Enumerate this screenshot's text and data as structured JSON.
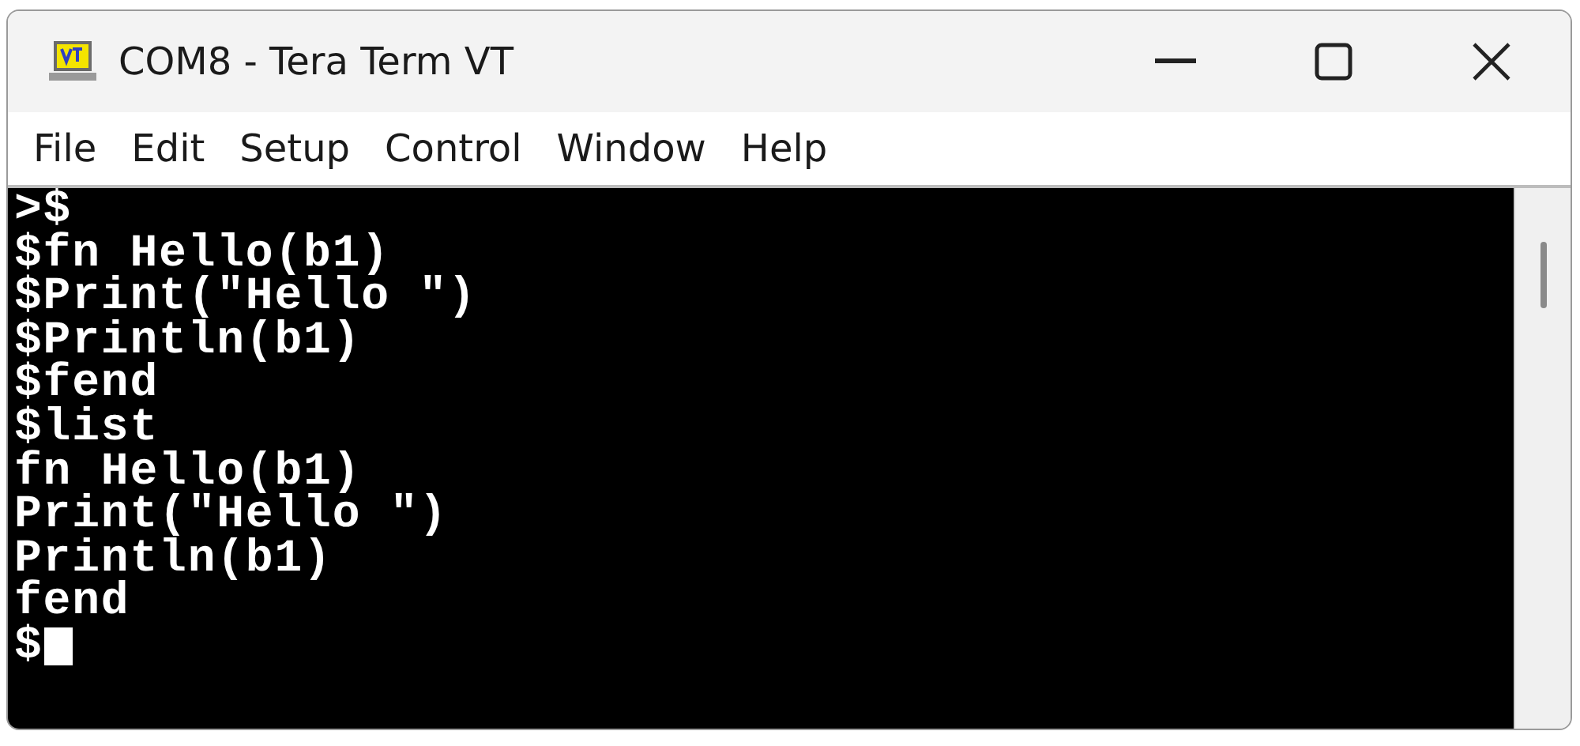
{
  "window": {
    "title": "COM8 - Tera Term VT"
  },
  "menu": [
    "File",
    "Edit",
    "Setup",
    "Control",
    "Window",
    "Help"
  ],
  "terminal": {
    "lines": [
      ">$",
      "$fn Hello(b1)",
      "$Print(\"Hello \")",
      "$Println(b1)",
      "$fend",
      "$list",
      "fn Hello(b1)",
      "Print(\"Hello \")",
      "Println(b1)",
      "fend",
      "$"
    ]
  }
}
